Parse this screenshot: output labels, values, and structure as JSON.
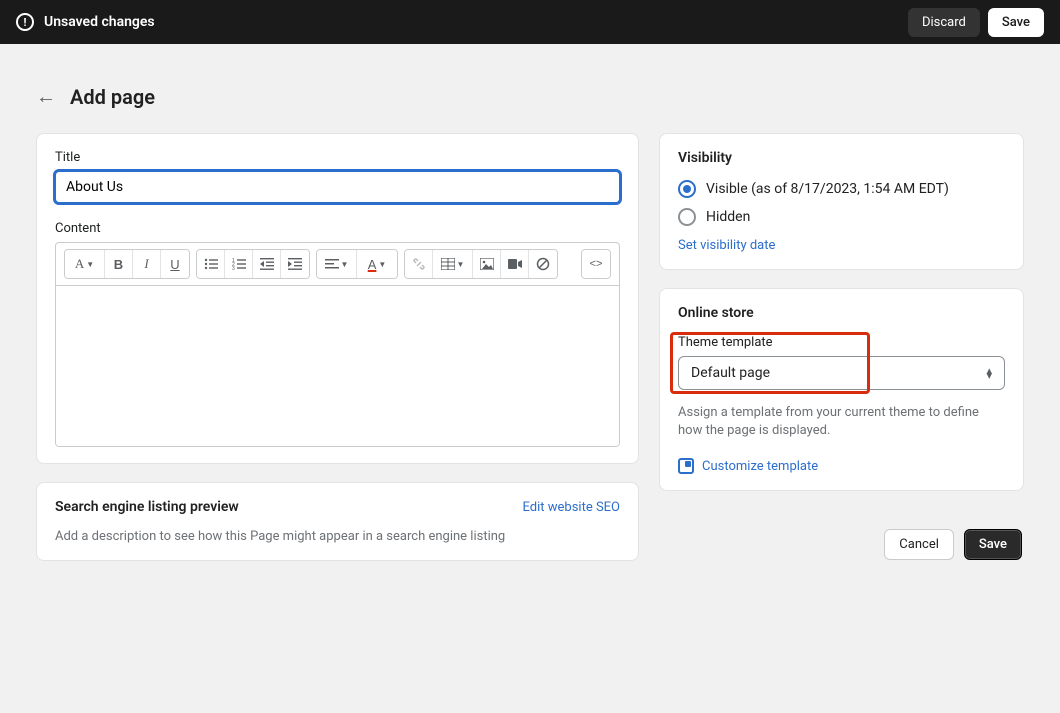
{
  "topbar": {
    "unsaved_label": "Unsaved changes",
    "discard_label": "Discard",
    "save_label": "Save"
  },
  "header": {
    "title": "Add page"
  },
  "form": {
    "title_label": "Title",
    "title_value": "About Us",
    "content_label": "Content"
  },
  "seo": {
    "title": "Search engine listing preview",
    "edit_link": "Edit website SEO",
    "description": "Add a description to see how this Page might appear in a search engine listing"
  },
  "visibility": {
    "title": "Visibility",
    "visible_label": "Visible (as of 8/17/2023, 1:54 AM EDT)",
    "hidden_label": "Hidden",
    "set_date_link": "Set visibility date"
  },
  "online_store": {
    "title": "Online store",
    "template_label": "Theme template",
    "selected_template": "Default page",
    "help_text": "Assign a template from your current theme to define how the page is displayed.",
    "customize_link": "Customize template"
  },
  "footer": {
    "cancel_label": "Cancel",
    "save_label": "Save"
  },
  "toolbar_icons": {
    "font": "font-family",
    "bold": "bold",
    "italic": "italic",
    "underline": "underline",
    "bullet": "bullet-list",
    "number": "numbered-list",
    "outdent": "outdent",
    "indent": "indent",
    "align": "align",
    "color": "text-color",
    "link": "link",
    "table": "table",
    "image": "image",
    "video": "video",
    "clear": "clear-format",
    "code": "code-view"
  }
}
